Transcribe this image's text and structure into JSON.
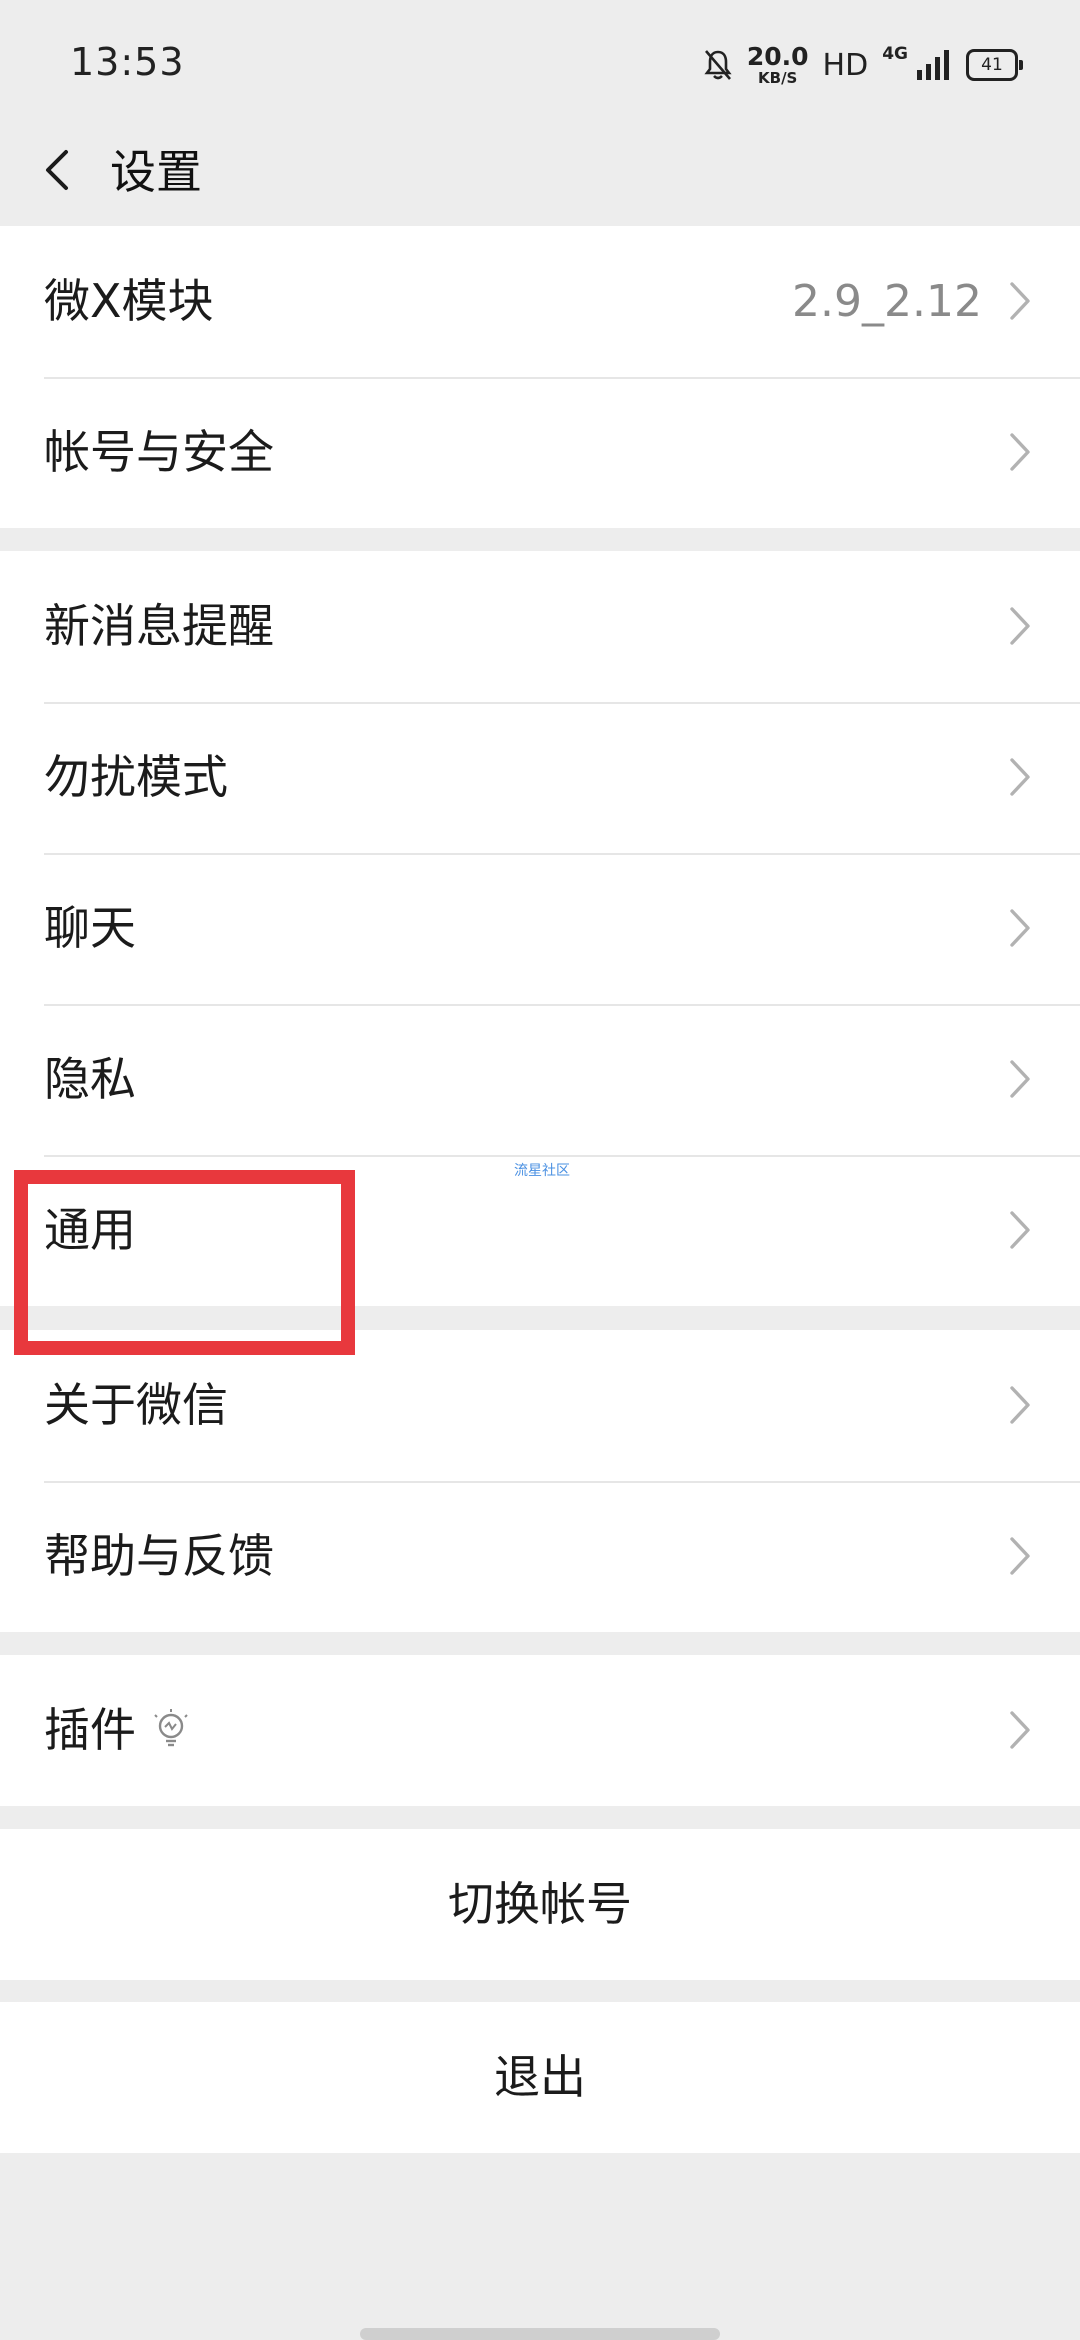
{
  "status_bar": {
    "time": "13:53",
    "speed_value": "20.0",
    "speed_unit": "KB/S",
    "hd": "HD",
    "network": "4G",
    "battery": "41"
  },
  "header": {
    "title": "设置"
  },
  "groups": [
    {
      "items": [
        {
          "label": "微X模块",
          "value": "2.9_2.12"
        },
        {
          "label": "帐号与安全"
        }
      ]
    },
    {
      "items": [
        {
          "label": "新消息提醒"
        },
        {
          "label": "勿扰模式"
        },
        {
          "label": "聊天"
        },
        {
          "label": "隐私"
        },
        {
          "label": "通用"
        }
      ]
    },
    {
      "items": [
        {
          "label": "关于微信"
        },
        {
          "label": "帮助与反馈"
        }
      ]
    },
    {
      "items": [
        {
          "label": "插件"
        }
      ]
    }
  ],
  "actions": {
    "switch_account": "切换帐号",
    "logout": "退出"
  },
  "watermark": "流星社区",
  "colors": {
    "highlight": "#e8383d",
    "background": "#ededed"
  }
}
